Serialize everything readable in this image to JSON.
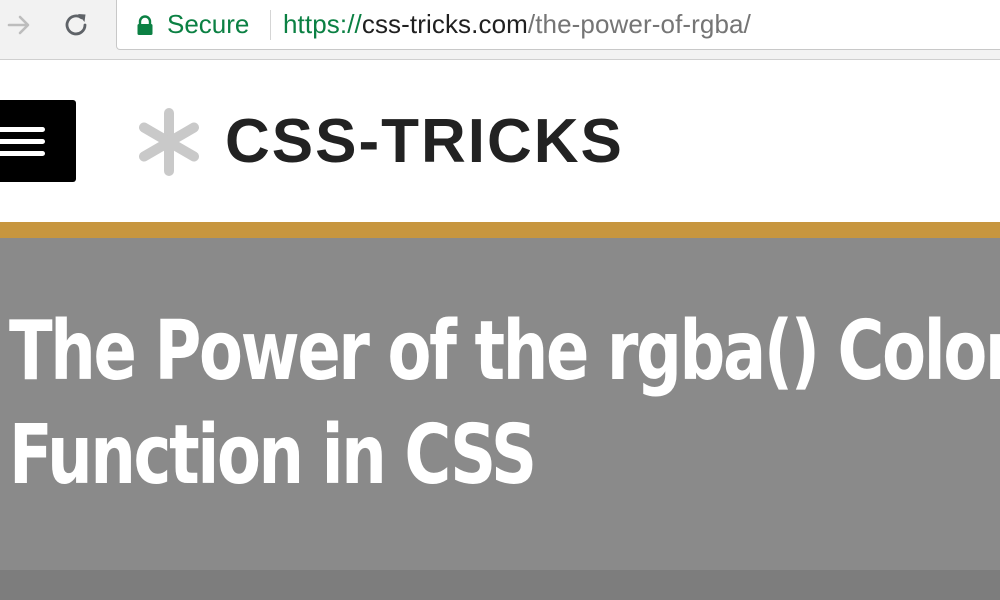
{
  "browser": {
    "security_label": "Secure",
    "url": {
      "scheme": "https://",
      "host": "css-tricks.com",
      "path": "/the-power-of-rgba/"
    },
    "icons": [
      "arrow-right-icon",
      "reload-icon",
      "lock-icon"
    ]
  },
  "site": {
    "logo_text": "CSS-TRICKS",
    "logo_icon": "asterisk-star-icon",
    "menu_icon": "hamburger-menu-icon"
  },
  "article": {
    "title_line1": "The Power of the rgba() Color",
    "title_line2": "Function in CSS"
  },
  "colors": {
    "secure_green": "#0b8043",
    "accent_stripe": "#c7963f",
    "hero_background": "#8a8a8a",
    "logo_star": "#c9c9c9"
  }
}
